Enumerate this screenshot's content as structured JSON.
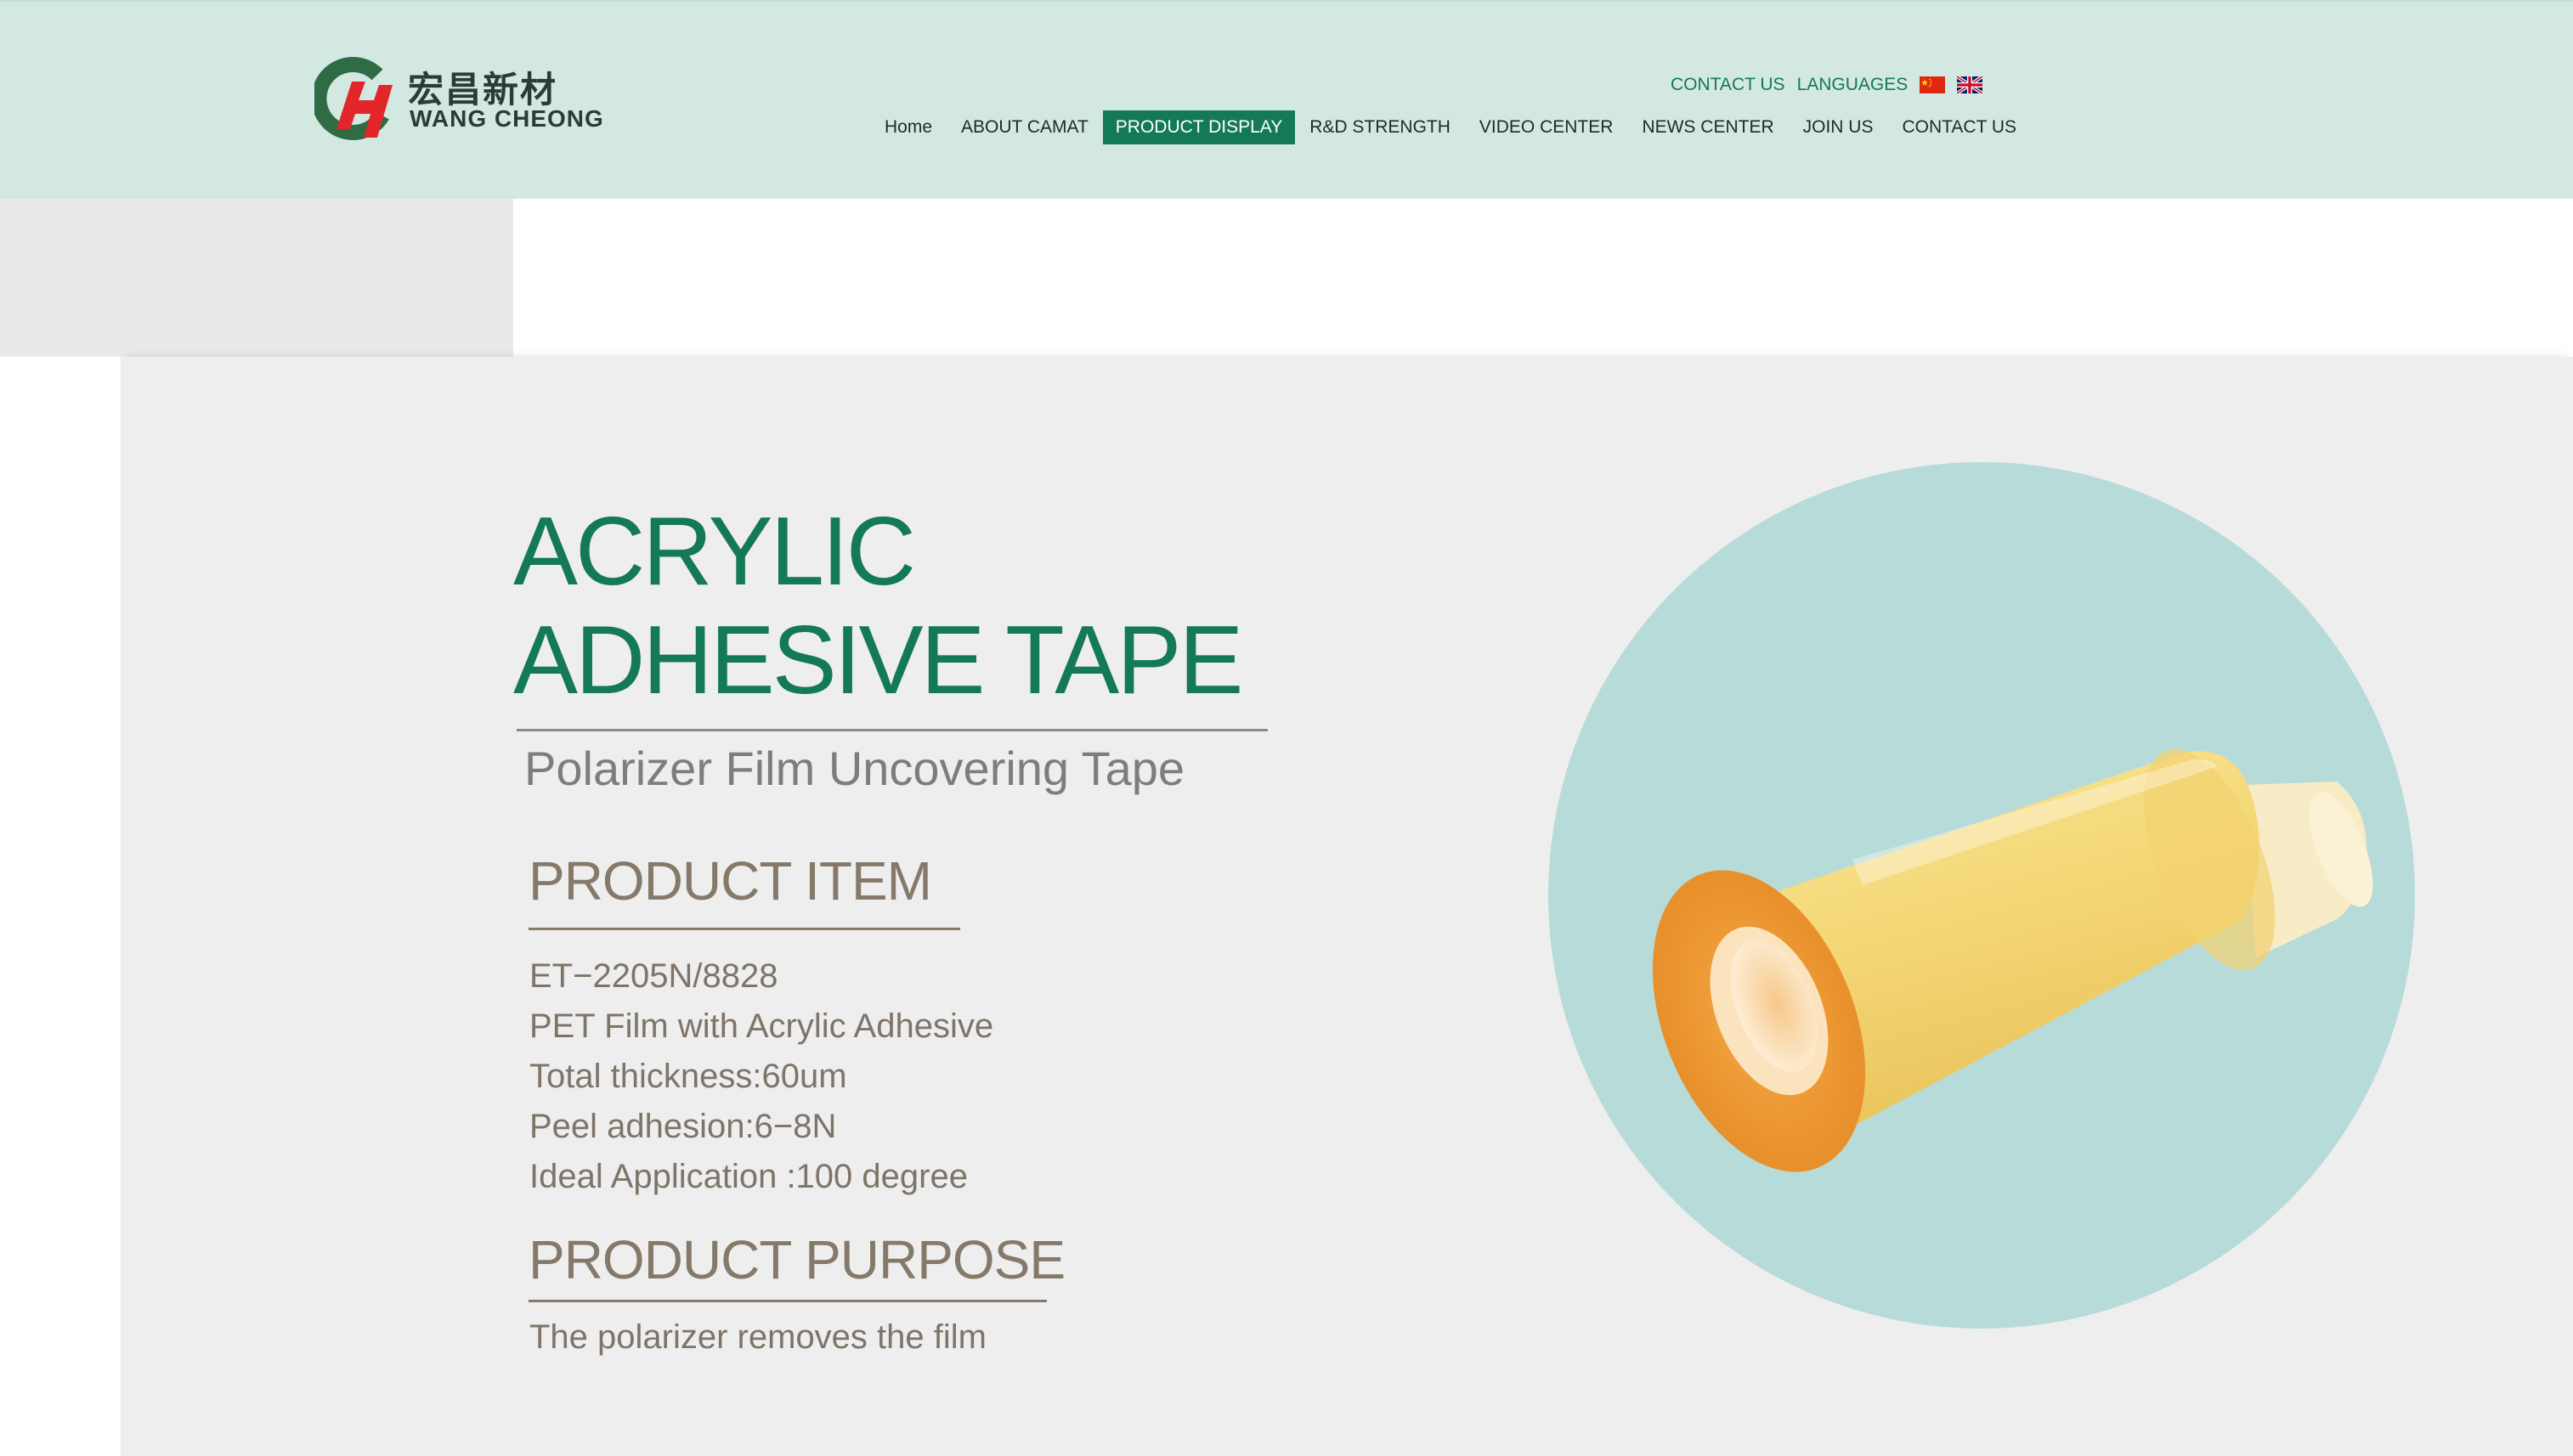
{
  "header": {
    "logo": {
      "chinese": "宏昌新材",
      "english": "WANG CHEONG"
    },
    "top_links": {
      "contact": "CONTACT US",
      "languages": "LANGUAGES"
    },
    "nav": [
      {
        "label": "Home"
      },
      {
        "label": "ABOUT CAMAT"
      },
      {
        "label": "PRODUCT DISPLAY",
        "active": true
      },
      {
        "label": "R&D STRENGTH"
      },
      {
        "label": "VIDEO CENTER"
      },
      {
        "label": "NEWS CENTER"
      },
      {
        "label": "JOIN US"
      },
      {
        "label": "CONTACT US"
      }
    ]
  },
  "product": {
    "title_line1": "ACRYLIC",
    "title_line2": "ADHESIVE TAPE",
    "subtitle": "Polarizer Film Uncovering Tape",
    "item_heading": "PRODUCT ITEM",
    "specs": [
      "ET−2205N/8828",
      "PET Film with Acrylic Adhesive",
      "Total thickness:60um",
      "Peel adhesion:6−8N",
      "Ideal Application :100 degree"
    ],
    "purpose_heading": "PRODUCT PURPOSE",
    "purpose_text": "The polarizer removes the film"
  },
  "colors": {
    "brand_green": "#137a55",
    "header_bg": "#d4e8e2",
    "circle_bg": "#b7dbd8",
    "tape_yellow": "#f4d776",
    "heading_brown": "#86796a"
  },
  "icons": [
    "logo-mark-icon",
    "china-flag-icon",
    "uk-flag-icon",
    "tape-roll-image"
  ]
}
